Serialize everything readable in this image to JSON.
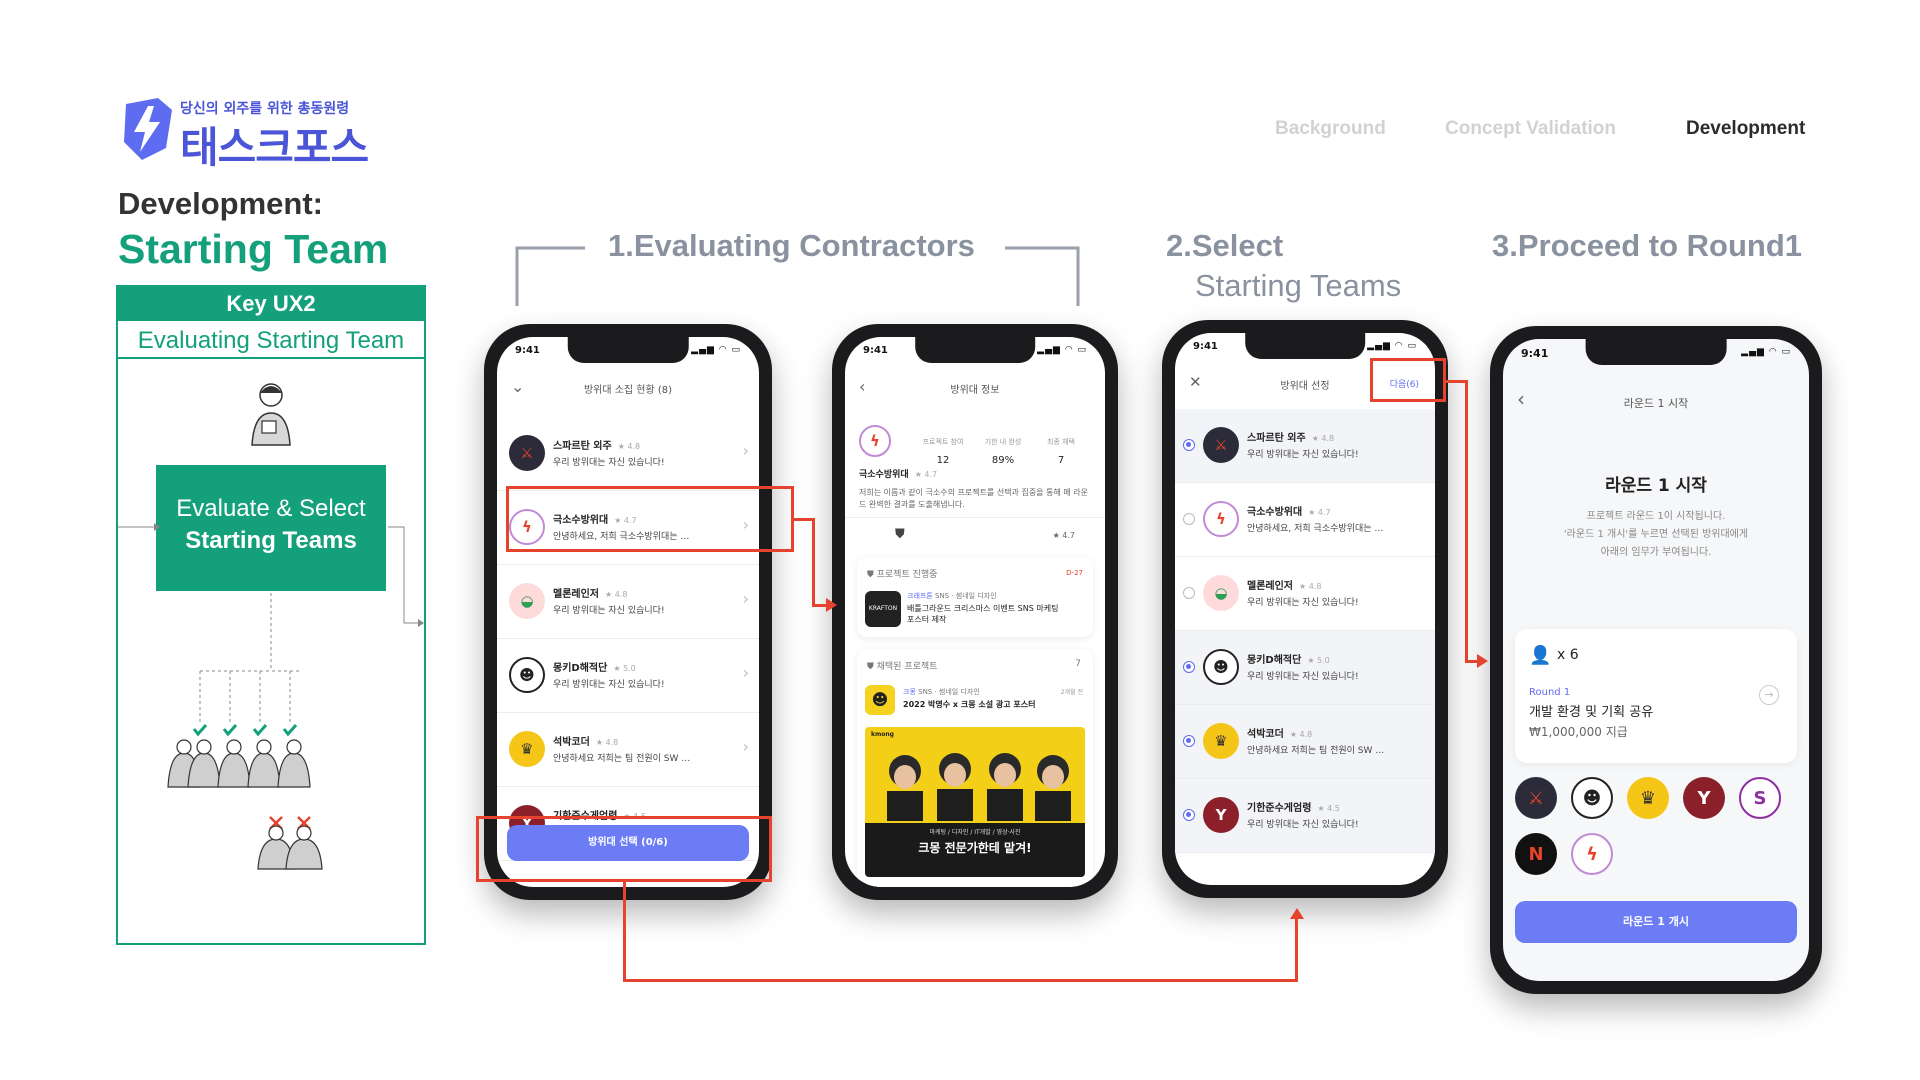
{
  "brand": {
    "tagline": "당신의 외주를 위한 총동원령",
    "name": "태스크포스"
  },
  "nav": [
    {
      "label": "Background",
      "active": false
    },
    {
      "label": "Concept Validation",
      "active": false
    },
    {
      "label": "Development",
      "active": true
    }
  ],
  "heading": {
    "label": "Development:",
    "title": "Starting Team"
  },
  "key_panel": {
    "head": "Key UX2",
    "subtitle": "Evaluating Starting Team",
    "box_line1": "Evaluate & Select",
    "box_line2": "Starting Teams"
  },
  "steps": {
    "step1": "1.Evaluating Contractors",
    "step2": "2.Select",
    "step2b": "Starting Teams",
    "step3": "3.Proceed to Round1"
  },
  "colors": {
    "accent": "#14a07a",
    "brand": "#4a55d8",
    "highlight": "#e6432e",
    "cta": "#6b7cf5"
  },
  "status_time": "9:41",
  "phone1": {
    "title": "방위대 소집 현황 (8)",
    "rows": [
      {
        "name": "스파르탄 외주",
        "rating": "★ 4.8",
        "desc": "우리 방위대는 자신 있습니다!",
        "icon": "spartan-logo"
      },
      {
        "name": "극소수방위대",
        "rating": "★ 4.7",
        "desc": "안녕하세요, 저희 극소수방위대는 …",
        "icon": "bolt-logo"
      },
      {
        "name": "멜론레인저",
        "rating": "★ 4.8",
        "desc": "우리 방위대는 자신 있습니다!",
        "icon": "melon-logo"
      },
      {
        "name": "몽키D해적단",
        "rating": "★ 5.0",
        "desc": "우리 방위대는 자신 있습니다!",
        "icon": "monkey-logo"
      },
      {
        "name": "석박코더",
        "rating": "★ 4.8",
        "desc": "안녕하세요 저희는 팀 전원이 SW …",
        "icon": "grad-logo"
      },
      {
        "name": "기한준수게엄령",
        "rating": "★ 4.5",
        "desc": "",
        "icon": "y-logo"
      }
    ],
    "cta": "방위대 선택 (0/6)"
  },
  "phone2": {
    "title": "방위대 정보",
    "stats": [
      {
        "label": "프로젝트 참여",
        "value": "12"
      },
      {
        "label": "기한 내 완성",
        "value": "89%"
      },
      {
        "label": "최종 채택",
        "value": "7"
      }
    ],
    "team_name": "극소수방위대",
    "team_rating": "★ 4.7",
    "intro": "저희는 이름과 같이 극소수의 프로젝트를 선택과 집중을 통해 매 라운드 완벽한 결과를 도출해냅니다.",
    "rating_small": "★ 4.7",
    "ongoing": {
      "header": "프로젝트 진행중",
      "dday": "D-27",
      "company": "크래프톤",
      "tags": "SNS · 썸네일 디자인",
      "title": "배틀그라운드 크리스마스 이벤트 SNS 마케팅 포스터 제작",
      "logo": "KRAFTON"
    },
    "adopted": {
      "header": "채택된 프로젝트",
      "count": "7",
      "company": "크몽",
      "tags": "SNS · 썸네일 디자인",
      "ago": "2개월 전",
      "title": "2022 박명수 x 크몽 소설 광고 포스터",
      "banner_brand": "kmong",
      "banner_tags": "마케팅 / 디자인 / IT개발 / 영상·사진",
      "banner_text": "크몽 전문가한테 맡겨!"
    }
  },
  "phone3": {
    "title": "방위대 선정",
    "next": "다음(6)",
    "rows": [
      {
        "name": "스파르탄 외주",
        "rating": "★ 4.8",
        "desc": "우리 방위대는 자신 있습니다!",
        "selected": true
      },
      {
        "name": "극소수방위대",
        "rating": "★ 4.7",
        "desc": "안녕하세요, 저희 극소수방위대는 …",
        "selected": false
      },
      {
        "name": "멜론레인저",
        "rating": "★ 4.8",
        "desc": "우리 방위대는 자신 있습니다!",
        "selected": false
      },
      {
        "name": "몽키D해적단",
        "rating": "★ 5.0",
        "desc": "우리 방위대는 자신 있습니다!",
        "selected": true
      },
      {
        "name": "석박코더",
        "rating": "★ 4.8",
        "desc": "안녕하세요 저희는 팀 전원이 SW …",
        "selected": true
      },
      {
        "name": "기한준수게엄령",
        "rating": "★ 4.5",
        "desc": "우리 방위대는 자신 있습니다!",
        "selected": true
      }
    ]
  },
  "phone4": {
    "title": "라운드 1 시작",
    "heading": "라운드 1 시작",
    "desc1": "프로젝트 라운드 1이 시작됩니다.",
    "desc2": "'라운드 1 개시'를 누르면 선택된 방위대에게",
    "desc3": "아래의 임무가 부여됩니다.",
    "count": "x 6",
    "round_label": "Round 1",
    "task": "개발 환경 및 기획 공유",
    "pay": "₩1,000,000 지급",
    "cta": "라운드 1 개시"
  }
}
